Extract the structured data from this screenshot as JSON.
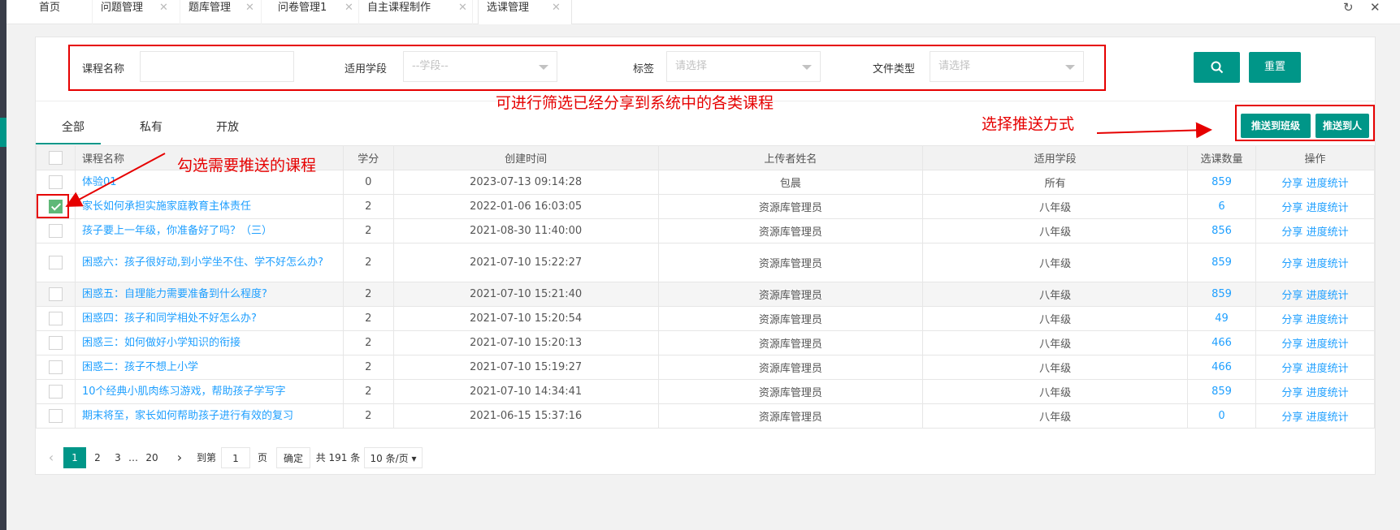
{
  "tabs": [
    {
      "label": "首页",
      "closable": false
    },
    {
      "label": "问题管理",
      "closable": true
    },
    {
      "label": "题库管理",
      "closable": true
    },
    {
      "label": "问卷管理1",
      "closable": true
    },
    {
      "label": "自主课程制作",
      "closable": true
    },
    {
      "label": "选课管理",
      "closable": true,
      "active": true
    }
  ],
  "filter": {
    "course_name_label": "课程名称",
    "course_name_value": "",
    "grade_label": "适用学段",
    "grade_placeholder": "--学段--",
    "tag_label": "标签",
    "tag_placeholder": "请选择",
    "filetype_label": "文件类型",
    "filetype_placeholder": "请选择",
    "reset_label": "重置"
  },
  "subtabs": [
    "全部",
    "私有",
    "开放"
  ],
  "push": {
    "to_class": "推送到班级",
    "to_person": "推送到人"
  },
  "table": {
    "headers": [
      "课程名称",
      "学分",
      "创建时间",
      "上传者姓名",
      "适用学段",
      "选课数量",
      "操作"
    ],
    "rows": [
      {
        "name": "体验01",
        "credit": "0",
        "created": "2023-07-13 09:14:28",
        "uploader": "包晨",
        "grade": "所有",
        "count": "859",
        "checked": false
      },
      {
        "name": "家长如何承担实施家庭教育主体责任",
        "credit": "2",
        "created": "2022-01-06 16:03:05",
        "uploader": "资源库管理员",
        "grade": "八年级",
        "count": "6",
        "checked": true
      },
      {
        "name": "孩子要上一年级，你准备好了吗？（三）",
        "credit": "2",
        "created": "2021-08-30 11:40:00",
        "uploader": "资源库管理员",
        "grade": "八年级",
        "count": "856",
        "checked": false
      },
      {
        "name": "困惑六：孩子很好动,到小学坐不住、学不好怎么办?",
        "credit": "2",
        "created": "2021-07-10 15:22:27",
        "uploader": "资源库管理员",
        "grade": "八年级",
        "count": "859",
        "checked": false
      },
      {
        "name": "困惑五：自理能力需要准备到什么程度?",
        "credit": "2",
        "created": "2021-07-10 15:21:40",
        "uploader": "资源库管理员",
        "grade": "八年级",
        "count": "859",
        "checked": false
      },
      {
        "name": "困惑四：孩子和同学相处不好怎么办?",
        "credit": "2",
        "created": "2021-07-10 15:20:54",
        "uploader": "资源库管理员",
        "grade": "八年级",
        "count": "49",
        "checked": false
      },
      {
        "name": "困惑三：如何做好小学知识的衔接",
        "credit": "2",
        "created": "2021-07-10 15:20:13",
        "uploader": "资源库管理员",
        "grade": "八年级",
        "count": "466",
        "checked": false
      },
      {
        "name": "困惑二：孩子不想上小学",
        "credit": "2",
        "created": "2021-07-10 15:19:27",
        "uploader": "资源库管理员",
        "grade": "八年级",
        "count": "466",
        "checked": false
      },
      {
        "name": "10个经典小肌肉练习游戏，帮助孩子学写字",
        "credit": "2",
        "created": "2021-07-10 14:34:41",
        "uploader": "资源库管理员",
        "grade": "八年级",
        "count": "859",
        "checked": false
      },
      {
        "name": "期末将至，家长如何帮助孩子进行有效的复习",
        "credit": "2",
        "created": "2021-06-15 15:37:16",
        "uploader": "资源库管理员",
        "grade": "八年级",
        "count": "0",
        "checked": false
      }
    ],
    "op_share": "分享",
    "op_progress": "进度统计"
  },
  "pager": {
    "pages": [
      "1",
      "2",
      "3",
      "…",
      "20"
    ],
    "goto_label": "到第",
    "goto_value": "1",
    "page_unit": "页",
    "confirm_label": "确定",
    "total": "共 191 条",
    "per_page": "10 条/页"
  },
  "annotations": {
    "filter_note": "可进行筛选已经分享到系统中的各类课程",
    "check_note": "勾选需要推送的课程",
    "push_note": "选择推送方式"
  },
  "colors": {
    "accent": "#009688",
    "link": "#1e9fff",
    "annotation": "#e60000"
  }
}
